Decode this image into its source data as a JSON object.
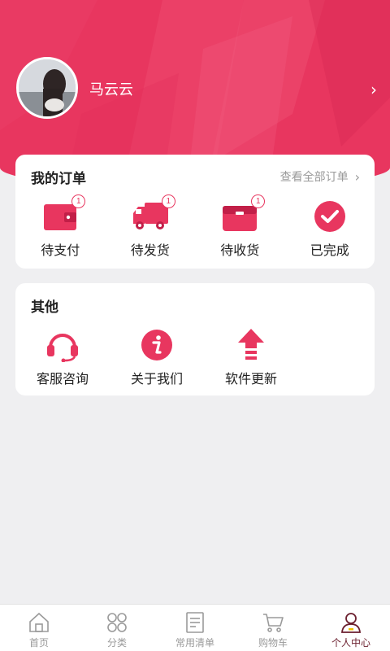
{
  "header": {
    "username": "马云云",
    "chevron": "›",
    "avatar_icon": "user-avatar-photo",
    "bg_color": "#e8365f"
  },
  "orders": {
    "title": "我的订单",
    "view_all": "查看全部订单",
    "items": [
      {
        "label": "待支付",
        "icon": "wallet-icon",
        "badge": "1"
      },
      {
        "label": "待发货",
        "icon": "truck-icon",
        "badge": "1"
      },
      {
        "label": "待收货",
        "icon": "box-icon",
        "badge": "1"
      },
      {
        "label": "已完成",
        "icon": "check-circle-icon"
      }
    ]
  },
  "other": {
    "title": "其他",
    "items": [
      {
        "label": "客服咨询",
        "icon": "headset-icon"
      },
      {
        "label": "关于我们",
        "icon": "info-icon"
      },
      {
        "label": "软件更新",
        "icon": "upload-icon"
      }
    ]
  },
  "tabbar": {
    "items": [
      {
        "label": "首页",
        "icon": "home-icon"
      },
      {
        "label": "分类",
        "icon": "category-icon"
      },
      {
        "label": "常用清单",
        "icon": "list-icon"
      },
      {
        "label": "购物车",
        "icon": "cart-icon"
      },
      {
        "label": "个人中心",
        "icon": "person-icon",
        "active": true
      }
    ]
  },
  "colors": {
    "accent": "#e8365f",
    "active_tab": "#6b1f2e"
  }
}
